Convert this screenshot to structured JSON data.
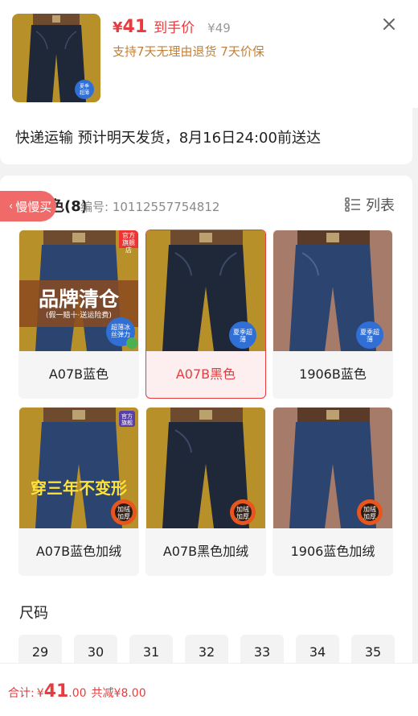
{
  "header": {
    "currency": "¥",
    "price": "41",
    "price_tag": "到手价",
    "original_price": "¥49",
    "promise": "支持7天无理由退货  7天价保",
    "close_icon": "close-icon"
  },
  "shipping": {
    "text": "快递运输 预计明天发货，8月16日24:00前送达"
  },
  "color_section": {
    "title_fragment": "色(8)",
    "code_label": "编号: 10112557754812",
    "list_label": "列表",
    "slow_label": "慢慢买",
    "options": [
      {
        "label": "A07B蓝色",
        "badge": "官方旗舰店",
        "overlay": "品牌清仓",
        "overlay_sub": "(假一赔十·送运险费)",
        "sticker": "超薄冰丝弹力",
        "selected": false,
        "tone": "blue"
      },
      {
        "label": "A07B黑色",
        "sticker": "夏季超薄",
        "selected": true,
        "tone": "black"
      },
      {
        "label": "1906B蓝色",
        "sticker": "夏季超薄",
        "selected": false,
        "tone": "blue"
      },
      {
        "label": "A07B蓝色加绒",
        "badge": "官方旗舰",
        "overlay": "穿三年不变形",
        "sticker": "加绒加厚",
        "selected": false,
        "tone": "blue"
      },
      {
        "label": "A07B黑色加绒",
        "sticker": "加绒加厚",
        "selected": false,
        "tone": "black"
      },
      {
        "label": "1906蓝色加绒",
        "sticker": "加绒加厚",
        "selected": false,
        "tone": "blue"
      }
    ]
  },
  "size_section": {
    "title": "尺码",
    "sizes": [
      "29",
      "30",
      "31",
      "32",
      "33",
      "34",
      "35"
    ]
  },
  "bottom": {
    "total_label": "合计:",
    "currency": "¥",
    "total_int": "41",
    "total_dec": ".00",
    "discount": "共减¥8.00"
  },
  "colors": {
    "accent": "#e93b3d",
    "promise": "#c2803a",
    "product_bg_gold": "#b8902a",
    "product_bg_brown": "#a67b69",
    "denim_blue": "#2b4470",
    "denim_black": "#1f2838"
  }
}
